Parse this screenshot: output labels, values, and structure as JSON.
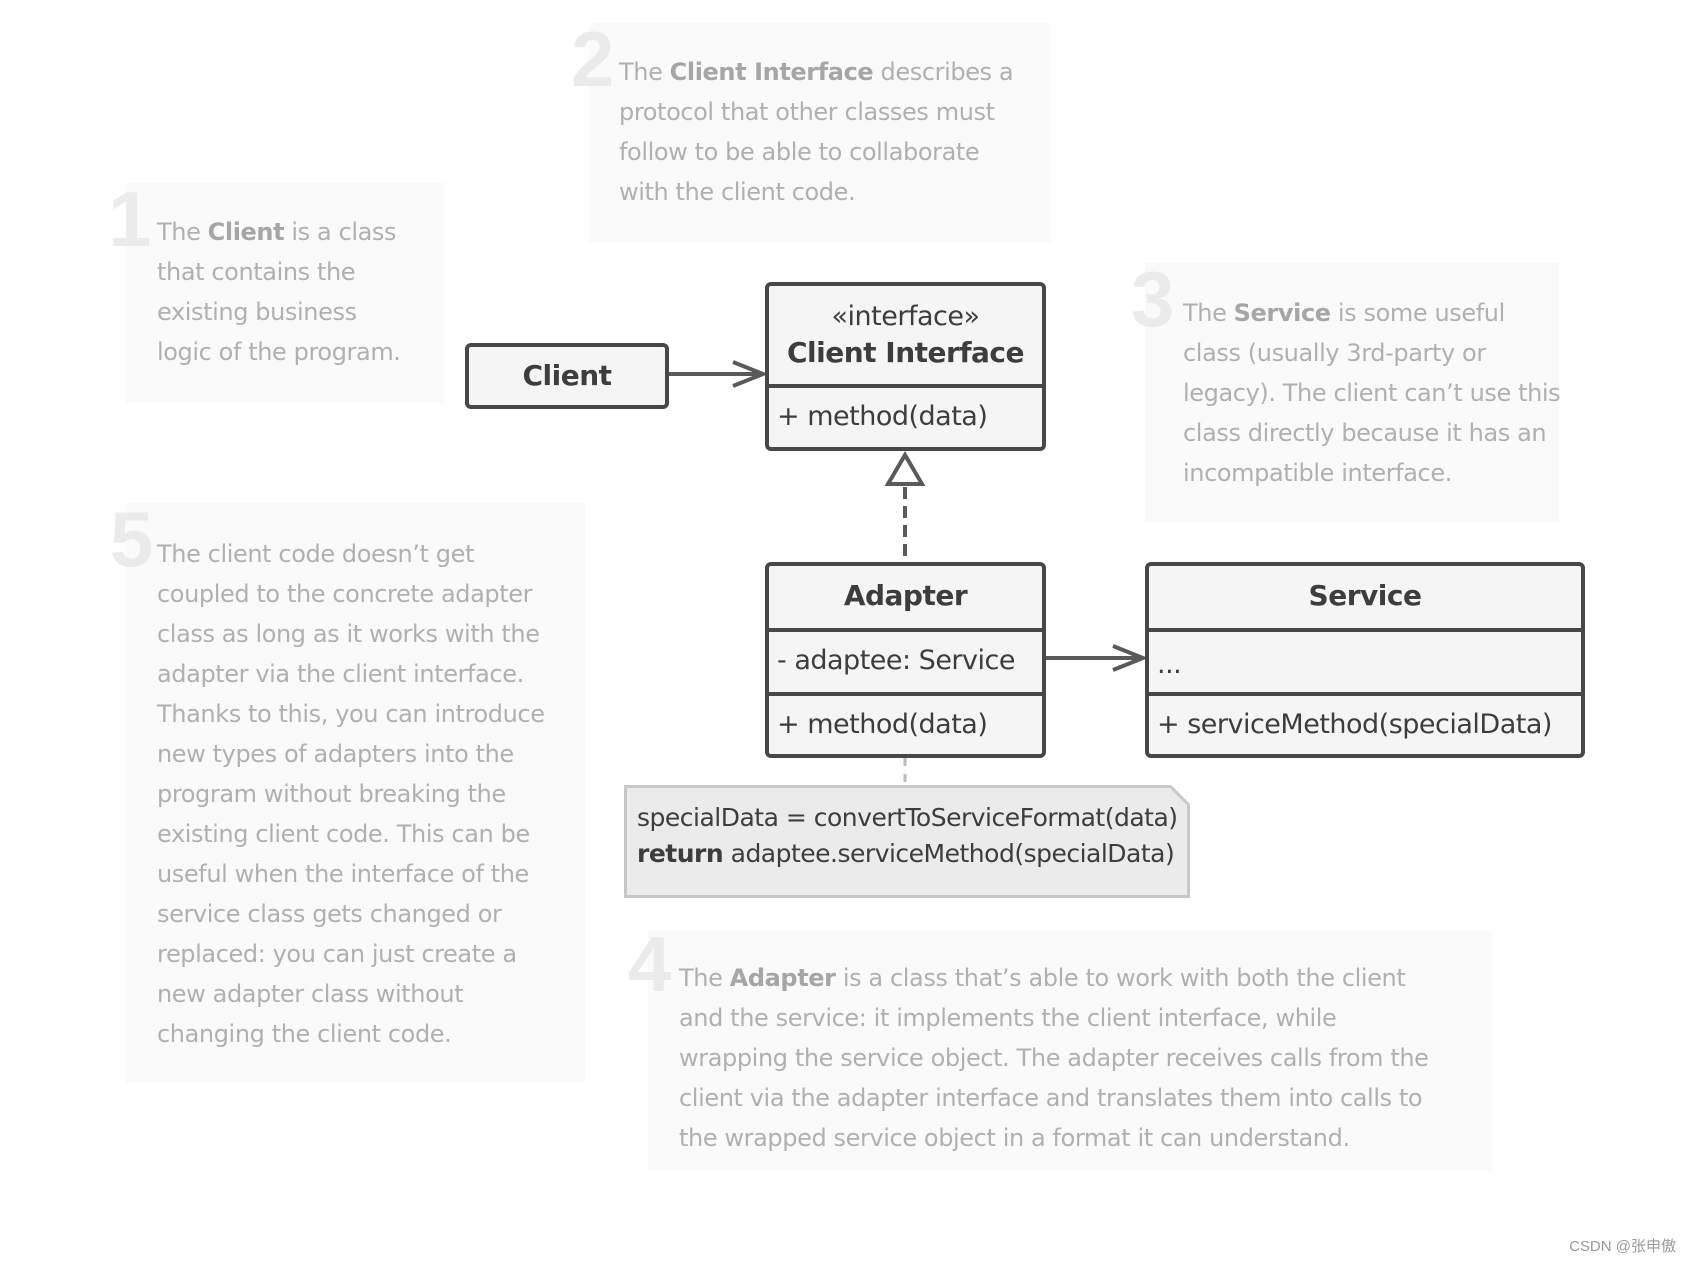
{
  "notes": [
    {
      "number": "1",
      "pre": "The ",
      "bold": "Client",
      "post": " is a class",
      "lines": [
        "that contains the",
        "existing business",
        "logic of the program."
      ]
    },
    {
      "number": "2",
      "pre": "The ",
      "bold": "Client Interface",
      "post": " describes a",
      "lines": [
        "protocol that other classes must",
        "follow to be able to collaborate",
        "with the client code."
      ]
    },
    {
      "number": "3",
      "pre": "The ",
      "bold": "Service",
      "post": " is some useful",
      "lines": [
        "class (usually 3rd-party or",
        "legacy). The client can’t use this",
        "class directly because it has an",
        "incompatible interface."
      ]
    },
    {
      "number": "4",
      "pre": "The ",
      "bold": "Adapter",
      "post": " is a class that’s able to work with both the client",
      "lines": [
        "and the service: it implements the client interface, while",
        "wrapping the service object. The adapter receives calls from the",
        "client via the adapter interface and translates them into calls to",
        "the wrapped service object in a format it can understand."
      ]
    },
    {
      "number": "5",
      "pre": "",
      "bold": "",
      "post": "The client code doesn’t get",
      "lines": [
        "coupled to the concrete adapter",
        "class as long as it works with the",
        "adapter via the client interface.",
        "Thanks to this, you can introduce",
        "new types of adapters into the",
        "program without breaking the",
        "existing client code. This can be",
        "useful when the interface of the",
        "service class gets changed or",
        "replaced: you can just create a",
        "new adapter class without",
        "changing the client code."
      ]
    }
  ],
  "classes": {
    "client": {
      "name": "Client"
    },
    "client_interface": {
      "stereotype": "«interface»",
      "name": "Client Interface",
      "methods": [
        "+ method(data)"
      ]
    },
    "adapter": {
      "name": "Adapter",
      "fields": [
        "- adaptee: Service"
      ],
      "methods": [
        "+ method(data)"
      ]
    },
    "service": {
      "name": "Service",
      "fields": [
        "..."
      ],
      "methods": [
        "+ serviceMethod(specialData)"
      ]
    }
  },
  "code_note": {
    "line1": "specialData = convertToServiceFormat(data)",
    "line2_keyword": "return",
    "line2_rest": " adaptee.serviceMethod(specialData)"
  },
  "relations": [
    {
      "from": "Client",
      "to": "Client Interface",
      "type": "association"
    },
    {
      "from": "Adapter",
      "to": "Client Interface",
      "type": "realization"
    },
    {
      "from": "Adapter",
      "to": "Service",
      "type": "association"
    },
    {
      "from": "Adapter",
      "to": "code_note",
      "type": "note-link"
    }
  ],
  "watermark": "CSDN @张申傲"
}
